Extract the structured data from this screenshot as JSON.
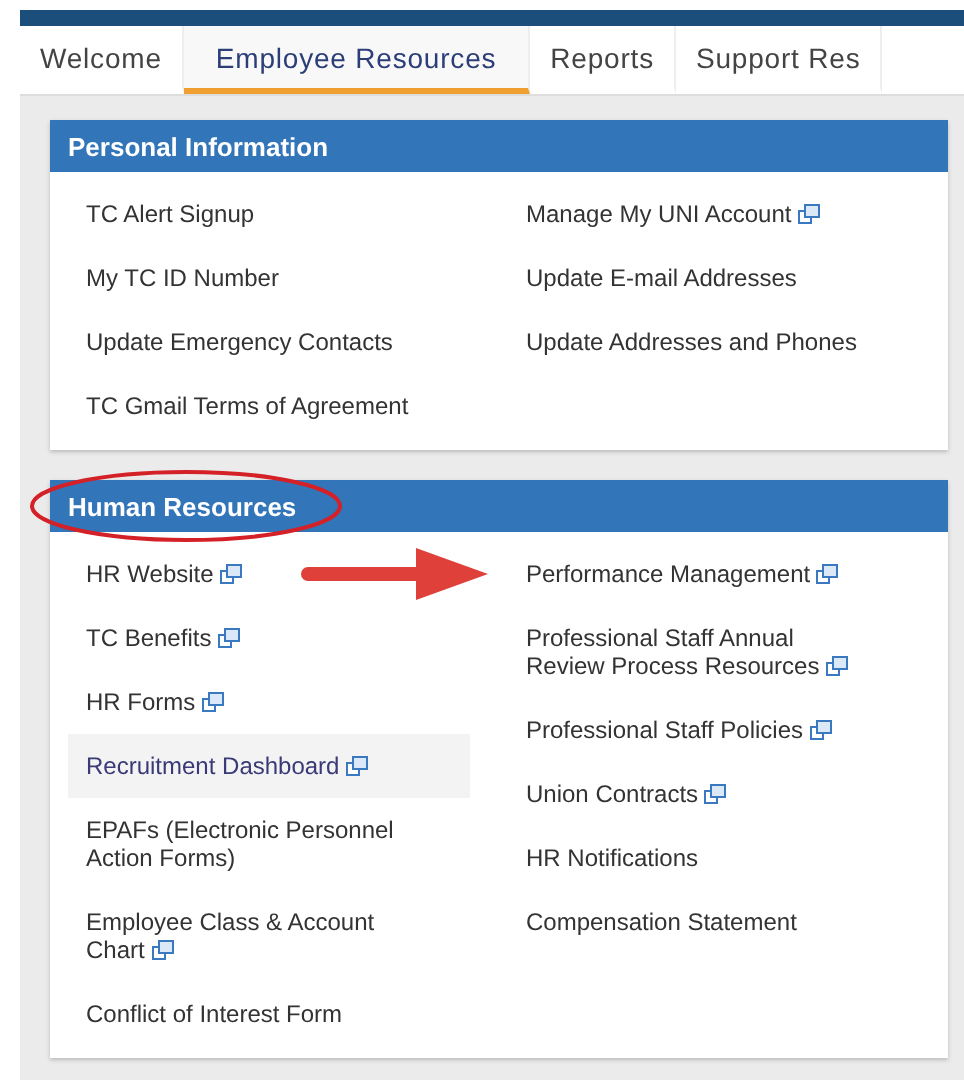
{
  "tabs": [
    {
      "label": "Welcome",
      "selected": false
    },
    {
      "label": "Employee Resources",
      "selected": true
    },
    {
      "label": "Reports",
      "selected": false
    },
    {
      "label": "Support Res",
      "selected": false
    }
  ],
  "panels": [
    {
      "title": "Personal Information",
      "circled": false,
      "left": [
        {
          "label": "TC Alert Signup",
          "external": false,
          "highlighted": false
        },
        {
          "label": "My TC ID Number",
          "external": false,
          "highlighted": false
        },
        {
          "label": "Update Emergency Contacts",
          "external": false,
          "highlighted": false
        },
        {
          "label": "TC Gmail Terms of Agreement",
          "external": false,
          "highlighted": false
        }
      ],
      "right": [
        {
          "label": "Manage My UNI Account",
          "external": true,
          "highlighted": false
        },
        {
          "label": "Update E-mail Addresses",
          "external": false,
          "highlighted": false
        },
        {
          "label": "Update Addresses and Phones",
          "external": false,
          "highlighted": false
        }
      ]
    },
    {
      "title": "Human Resources",
      "circled": true,
      "left": [
        {
          "label": "HR Website",
          "external": true,
          "highlighted": false
        },
        {
          "label": "TC Benefits",
          "external": true,
          "highlighted": false
        },
        {
          "label": "HR Forms",
          "external": true,
          "highlighted": false
        },
        {
          "label": "Recruitment Dashboard",
          "external": true,
          "highlighted": true
        },
        {
          "label": "EPAFs (Electronic Personnel Action Forms)",
          "external": false,
          "highlighted": false
        },
        {
          "label": "Employee Class & Account Chart",
          "external": true,
          "highlighted": false
        },
        {
          "label": "Conflict of Interest Form",
          "external": false,
          "highlighted": false
        }
      ],
      "right": [
        {
          "label": "Performance Management",
          "external": true,
          "highlighted": false,
          "pointed": true
        },
        {
          "label": "Professional Staff Annual Review Process Resources",
          "external": true,
          "highlighted": false
        },
        {
          "label": "Professional Staff Policies",
          "external": true,
          "highlighted": false
        },
        {
          "label": "Union Contracts",
          "external": true,
          "highlighted": false
        },
        {
          "label": "HR Notifications",
          "external": false,
          "highlighted": false
        },
        {
          "label": "Compensation Statement",
          "external": false,
          "highlighted": false
        }
      ]
    }
  ]
}
